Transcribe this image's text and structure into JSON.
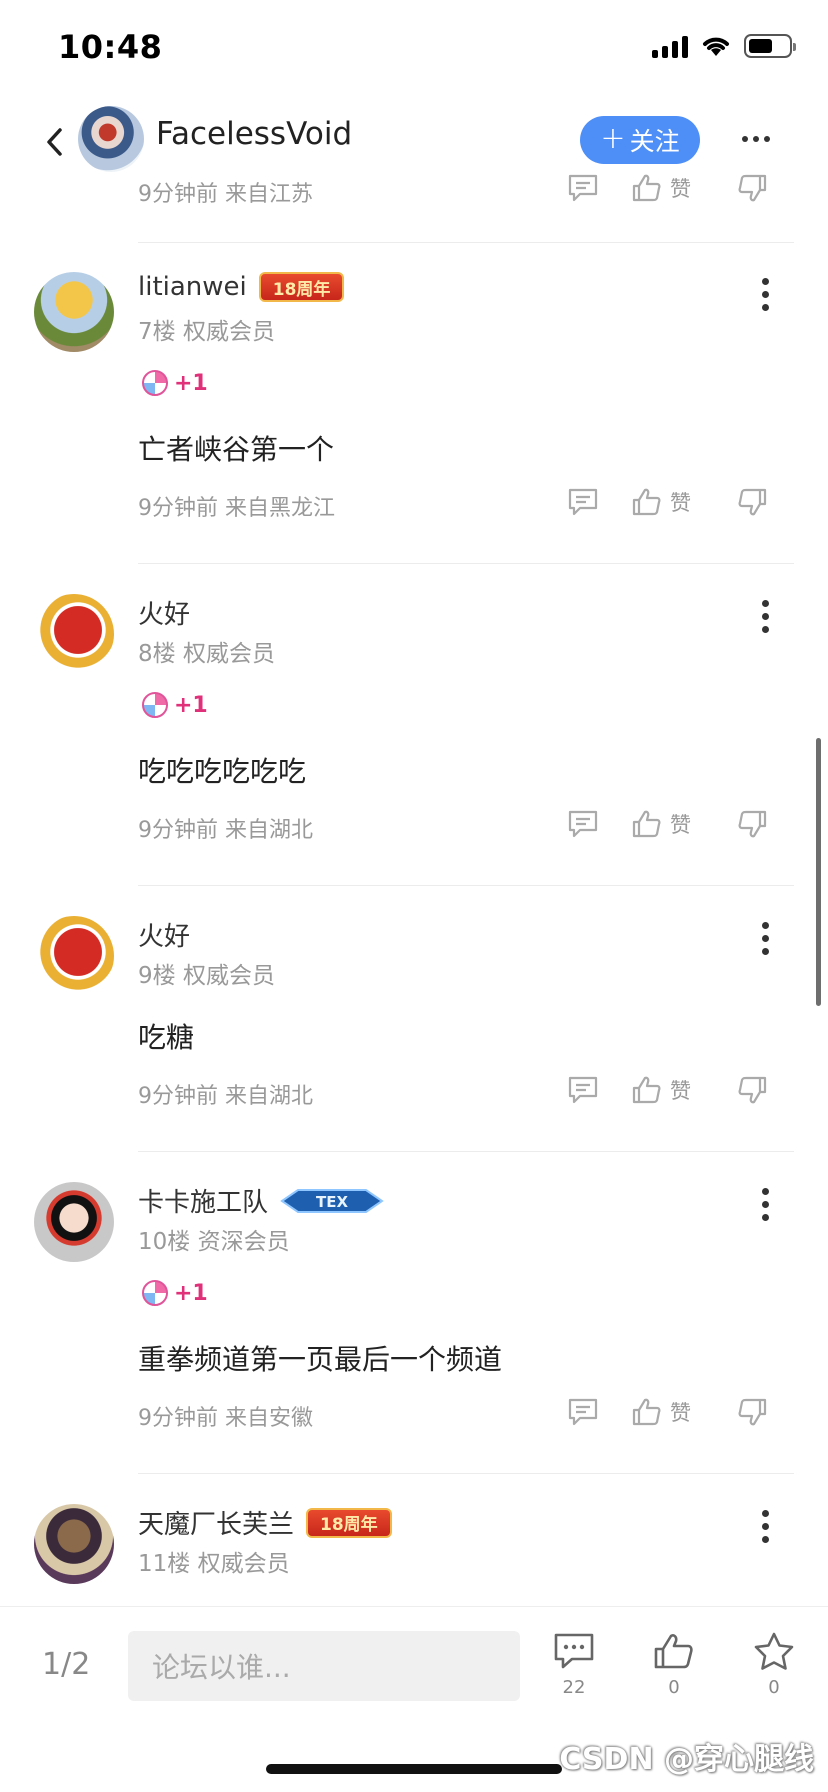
{
  "status_bar": {
    "time": "10:48"
  },
  "header": {
    "name": "FacelessVoid",
    "follow_label": "关注"
  },
  "partial_comment": {
    "meta": "9分钟前 来自江苏",
    "like_label": "赞"
  },
  "comments": [
    {
      "username": "litianwei",
      "badge": "18周年",
      "floor": "7楼  权威会员",
      "plus_one": "+1",
      "content": "亡者峡谷第一个",
      "meta": "9分钟前 来自黑龙江",
      "like_label": "赞"
    },
    {
      "username": "火好",
      "floor": "8楼  权威会员",
      "plus_one": "+1",
      "content": "吃吃吃吃吃吃",
      "meta": "9分钟前 来自湖北",
      "like_label": "赞"
    },
    {
      "username": "火好",
      "floor": "9楼  权威会员",
      "content": "吃糖",
      "meta": "9分钟前 来自湖北",
      "like_label": "赞"
    },
    {
      "username": "卡卡施工队",
      "badge": "TEX",
      "floor": "10楼  资深会员",
      "plus_one": "+1",
      "content": "重拳频道第一页最后一个频道",
      "meta": "9分钟前 来自安徽",
      "like_label": "赞"
    },
    {
      "username": "天魔厂长芙兰",
      "badge": "18周年",
      "floor": "11楼  权威会员"
    }
  ],
  "bottom_bar": {
    "page": "1/2",
    "input_placeholder": "论坛以谁...",
    "comment_count": "22",
    "like_count": "0",
    "favorite_count": "0"
  },
  "watermark": "CSDN @穿心腿线"
}
